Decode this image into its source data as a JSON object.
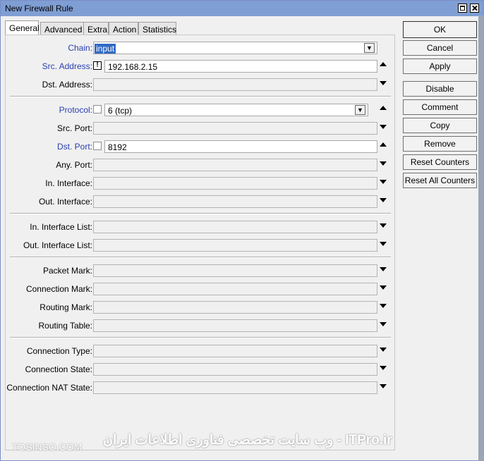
{
  "window": {
    "title": "New Firewall Rule"
  },
  "tabs": [
    "General",
    "Advanced",
    "Extra",
    "Action",
    "Statistics"
  ],
  "active_tab": "General",
  "fields": {
    "chain": {
      "label": "Chain:",
      "value": "input"
    },
    "src_address": {
      "label": "Src. Address:",
      "value": "192.168.2.15",
      "negate": "!"
    },
    "dst_address": {
      "label": "Dst. Address:",
      "value": ""
    },
    "protocol": {
      "label": "Protocol:",
      "value": "6 (tcp)"
    },
    "src_port": {
      "label": "Src. Port:",
      "value": ""
    },
    "dst_port": {
      "label": "Dst. Port:",
      "value": "8192"
    },
    "any_port": {
      "label": "Any. Port:",
      "value": ""
    },
    "in_interface": {
      "label": "In. Interface:",
      "value": ""
    },
    "out_interface": {
      "label": "Out. Interface:",
      "value": ""
    },
    "in_interface_list": {
      "label": "In. Interface List:",
      "value": ""
    },
    "out_interface_list": {
      "label": "Out. Interface List:",
      "value": ""
    },
    "packet_mark": {
      "label": "Packet Mark:",
      "value": ""
    },
    "connection_mark": {
      "label": "Connection Mark:",
      "value": ""
    },
    "routing_mark": {
      "label": "Routing Mark:",
      "value": ""
    },
    "routing_table": {
      "label": "Routing Table:",
      "value": ""
    },
    "connection_type": {
      "label": "Connection Type:",
      "value": ""
    },
    "connection_state": {
      "label": "Connection State:",
      "value": ""
    },
    "connection_nat_state": {
      "label": "Connection NAT State:",
      "value": ""
    }
  },
  "buttons": {
    "ok": "OK",
    "cancel": "Cancel",
    "apply": "Apply",
    "disable": "Disable",
    "comment": "Comment",
    "copy": "Copy",
    "remove": "Remove",
    "reset_counters": "Reset Counters",
    "reset_all_counters": "Reset All Counters"
  },
  "watermark": {
    "left": "TOSINSO.COM",
    "center": "ITPro.ir - وب سایت تخصصی فناوری اطلاعات ایران"
  },
  "colors": {
    "titlebar": "#7f9ed3",
    "label_blue": "#2a3fb0",
    "selection": "#316ac5"
  }
}
